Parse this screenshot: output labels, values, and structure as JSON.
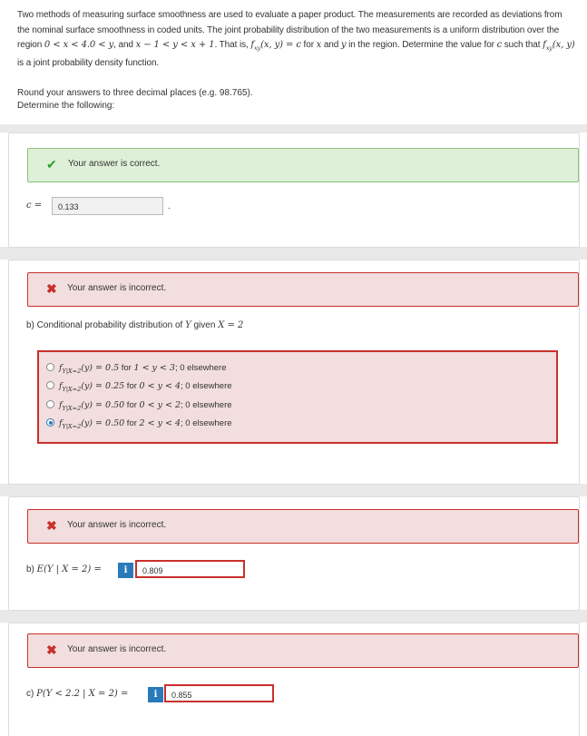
{
  "intro": {
    "s1": "Two methods of measuring surface smoothness are used to evaluate a paper product. The measurements are recorded as deviations from the nominal surface smoothness in coded units. The joint probability distribution of the two measurements is a uniform distribution over the region ",
    "region1": "0 < x < 4.0 < y",
    "s2": ", and ",
    "region2": "x − 1 < y < x + 1",
    "s3": ". That is, ",
    "fxy": "f",
    "fxy_sub": "xy",
    "fxy_args": "(x, y) = c",
    "s4": " for ",
    "vx": "x",
    "s5": " and ",
    "vy": "y",
    "s6": " in the region. Determine the value for ",
    "vc": "c",
    "s7": " such that ",
    "fxy2": "f",
    "fxy2_sub": "xy",
    "fxy2_args": "(x, y)",
    "s8": " is a joint probability density function."
  },
  "instructions": {
    "round": "Round your answers to three decimal places (e.g. 98.765).",
    "determine": "Determine the following:"
  },
  "part_a": {
    "feedback": "Your answer is correct.",
    "label": "c =",
    "value": "0.133",
    "trailing": "."
  },
  "part_b1": {
    "feedback": "Your answer is incorrect.",
    "question_prefix": "b) Conditional probability distribution of ",
    "question_var": "Y",
    "question_mid": " given ",
    "question_given": "X = 2",
    "options": [
      {
        "f": "f",
        "sub": "Y|X=2",
        "expr": "(y) = 0.5",
        "mid": " for ",
        "range": "1 < y < 3",
        "tail": "; 0 elsewhere",
        "selected": false
      },
      {
        "f": "f",
        "sub": "Y|X=2",
        "expr": "(y) = 0.25",
        "mid": " for ",
        "range": "0 < y < 4",
        "tail": "; 0 elsewhere",
        "selected": false
      },
      {
        "f": "f",
        "sub": "Y|X=2",
        "expr": "(y) = 0.50",
        "mid": " for ",
        "range": "0 < y < 2",
        "tail": "; 0 elsewhere",
        "selected": false
      },
      {
        "f": "f",
        "sub": "Y|X=2",
        "expr": "(y) = 0.50",
        "mid": " for ",
        "range": "2 < y < 4",
        "tail": "; 0 elsewhere",
        "selected": true
      }
    ]
  },
  "part_b2": {
    "feedback": "Your answer is incorrect.",
    "label_prefix": "b) ",
    "label_math": "E(Y | X = 2) =",
    "info": "i",
    "value": "0.809"
  },
  "part_c": {
    "feedback": "Your answer is incorrect.",
    "label_prefix": "c) ",
    "label_math": "P(Y < 2.2 | X = 2) =",
    "info": "i",
    "value": "0.855"
  },
  "icons": {
    "check": "✔",
    "cross": "✖"
  },
  "colors": {
    "correct_bg": "#dff0d8",
    "incorrect_bg": "#f2dede",
    "error_border": "#c9302c",
    "info_blue": "#2a7ab9"
  }
}
